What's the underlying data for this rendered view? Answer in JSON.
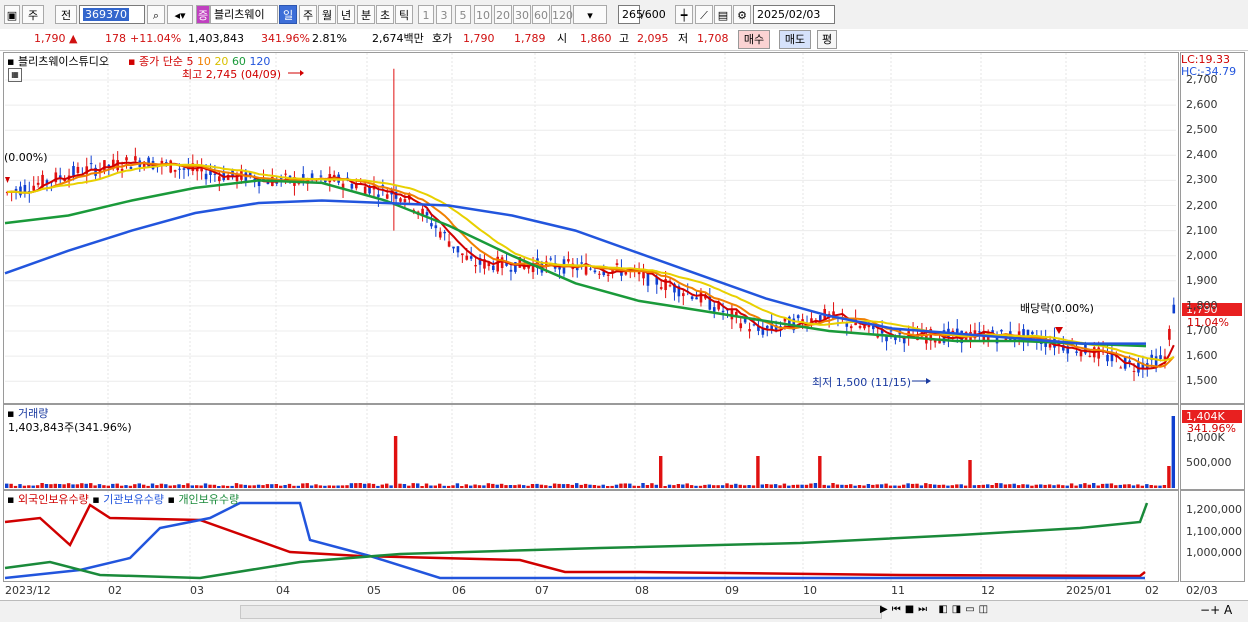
{
  "toolbar": {
    "period_unit": "주",
    "prev": "전",
    "code": "369370",
    "stock_name": "블리츠웨이",
    "intervals": [
      "일",
      "주",
      "월",
      "년",
      "분",
      "초",
      "틱"
    ],
    "active_interval": "일",
    "multipliers": [
      "1",
      "3",
      "5",
      "10",
      "20",
      "30",
      "60",
      "120"
    ],
    "count": "265",
    "count_total": "/600",
    "date": "2025/02/03"
  },
  "info": {
    "price": "1,790",
    "change": "178",
    "change_pct": "+11.04%",
    "volume": "1,403,843",
    "volume_ratio": "341.96%",
    "turnover": "2.81%",
    "amount": "2,674백만",
    "quote_label": "호가",
    "ask": "1,790",
    "bid": "1,789",
    "open_label": "시",
    "open": "1,860",
    "high_label": "고",
    "high": "2,095",
    "low_label": "저",
    "low": "1,708",
    "buy_button": "매수",
    "sell_button": "매도",
    "eval_button": "평"
  },
  "price_panel": {
    "name": "블리츠웨이스튜디오",
    "ma_label": "종가 단순",
    "ma_periods": [
      "5",
      "10",
      "20",
      "60",
      "120"
    ],
    "ma_colors": [
      "#d00000",
      "#f08000",
      "#e8d000",
      "#1a9a3a",
      "#2255dd"
    ],
    "high_marker": "최고 2,745 (04/09)",
    "low_marker": "최저 1,500 (11/15)",
    "dividend_left": "(0.00%)",
    "dividend_right": "배당락(0.00%)",
    "lc": "LC:19.33",
    "hc": "HC:-34.79",
    "current_tag": "1,790",
    "current_pct": "11.04%"
  },
  "volume_panel": {
    "title": "거래량",
    "value": "1,403,843주(341.96%)",
    "current_tag": "1,404K",
    "current_pct": "341.96%"
  },
  "holding_panel": {
    "series": [
      "외국인보유수량",
      "기관보유수량",
      "개인보유수량"
    ],
    "colors": [
      "#d00000",
      "#2255dd",
      "#1a8a3a"
    ]
  },
  "chart_data": [
    {
      "type": "line",
      "title": "블리츠웨이스튜디오",
      "y_ticks": [
        "2,700",
        "2,600",
        "2,500",
        "2,400",
        "2,300",
        "2,200",
        "2,100",
        "2,000",
        "1,900",
        "1,800",
        "1,700",
        "1,600",
        "1,500"
      ],
      "x_ticks": [
        "2023/12",
        "02",
        "03",
        "04",
        "05",
        "06",
        "07",
        "08",
        "09",
        "10",
        "11",
        "12",
        "2025/01",
        "02"
      ],
      "series": [
        {
          "name": "종가 단순 120",
          "values": [
            1930,
            2020,
            2100,
            2170,
            2210,
            2220,
            2210,
            2200,
            2160,
            2100,
            2010,
            1920,
            1830,
            1760,
            1710,
            1690,
            1670,
            1650,
            1650
          ]
        },
        {
          "name": "종가 단순 60",
          "values": [
            2130,
            2160,
            2220,
            2270,
            2300,
            2290,
            2220,
            2120,
            2000,
            1890,
            1820,
            1780,
            1740,
            1700,
            1680,
            1660,
            1660,
            1650,
            1640
          ]
        }
      ]
    },
    {
      "type": "bar",
      "title": "거래량",
      "y_ticks": [
        "1,000K",
        "500,000"
      ]
    },
    {
      "type": "line",
      "title": "외국인보유수량",
      "y_ticks": [
        "1,200,000",
        "1,100,000",
        "1,000,000"
      ]
    }
  ],
  "bottom": {
    "zoom_minus": "−",
    "zoom_plus": "+",
    "auto": "A"
  }
}
